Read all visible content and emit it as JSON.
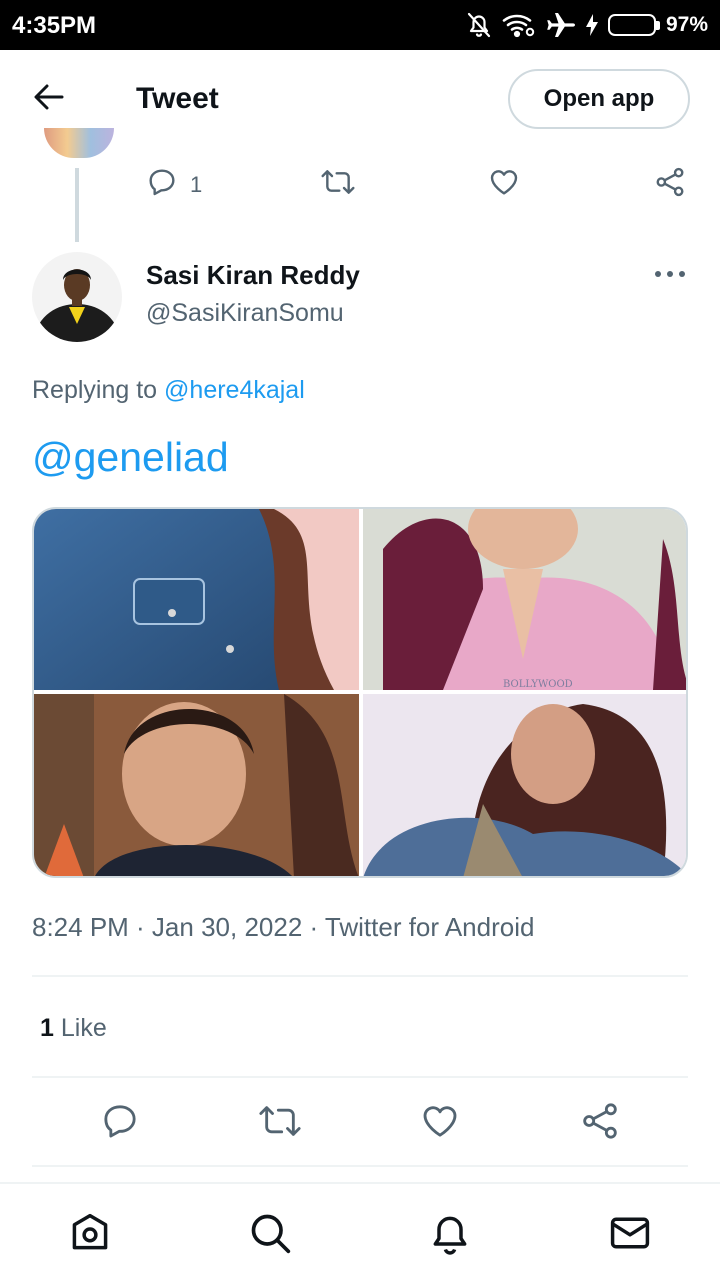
{
  "status_bar": {
    "time": "4:35PM",
    "battery_percent": "97%",
    "battery_level": 0.97,
    "icons": [
      "mute-icon",
      "wifi-icon",
      "airplane-icon",
      "charging-icon",
      "battery-icon"
    ]
  },
  "header": {
    "back_icon": "arrow-left-icon",
    "title": "Tweet",
    "open_app_label": "Open app"
  },
  "previous_tweet_actions": {
    "reply_count": "1",
    "icons": [
      "reply-icon",
      "retweet-icon",
      "like-icon",
      "share-icon"
    ]
  },
  "tweet": {
    "author_name": "Sasi Kiran Reddy",
    "author_handle": "@SasiKiranSomu",
    "replying_prefix": "Replying to",
    "replying_to": "@here4kajal",
    "text": "@geneliad",
    "timestamp": "8:24 PM · Jan 30, 2022 · Twitter for Android",
    "like_count": "1",
    "like_label": "Like",
    "media_watermark": "BOLLYWOOD"
  },
  "bottom_nav": {
    "items": [
      "home-icon",
      "search-icon",
      "notifications-icon",
      "messages-icon"
    ]
  },
  "colors": {
    "accent": "#1d9bf0",
    "text_primary": "#0f1419",
    "text_secondary": "#536471",
    "border": "#cfd9de"
  }
}
